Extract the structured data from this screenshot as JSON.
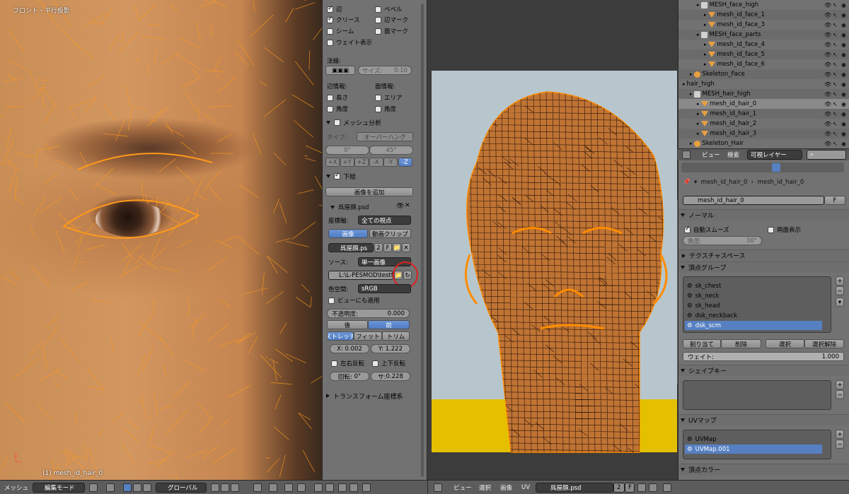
{
  "viewport_left": {
    "label": "フロント・平行投影",
    "object_label": "(1) mesh_id_hair_0"
  },
  "props": {
    "cb_edges": "辺",
    "cb_bevel": "ベベル",
    "cb_crease": "クリース",
    "cb_edge_mark": "辺マーク",
    "cb_seam": "シーム",
    "cb_face_mark": "面マーク",
    "cb_weight": "ウェイト表示",
    "normals_label": "法線:",
    "size_label": "サイズ:",
    "size_value": "0.10",
    "edge_info": "辺情報:",
    "face_info": "面情報:",
    "length": "長さ",
    "area": "エリア",
    "angle1": "角度",
    "angle2": "角度",
    "mesh_analysis": "メッシュ分析",
    "type_label": "タイプ:",
    "type_value": "オーバーハング",
    "min_angle": "0°",
    "max_angle": "45°",
    "axes": [
      "+X",
      "+Y",
      "+Z",
      "-X",
      "-Y",
      "-Z"
    ],
    "background": "下絵",
    "add_image": "画像を追加",
    "image_name": "呉屋顔.psd",
    "axis_label": "座標軸:",
    "axis_value": "全ての視点",
    "tab_image": "画像",
    "tab_movie": "動画クリップ",
    "img_field": "呉屋顔.ps",
    "img_num": "2",
    "img_f": "F",
    "source_label": "ソース:",
    "source_value": "単一画像",
    "filepath": "L:\\L-PESMOD\\testf...",
    "colorspace_label": "色空間:",
    "colorspace_value": "sRGB",
    "apply_view": "ビューにも適用",
    "opacity_label": "不透明度:",
    "opacity_value": "0.000",
    "back": "後",
    "front": "前",
    "stretch": "ストレッチ",
    "fit": "フィット",
    "trim": "トリム",
    "x_label": "X:",
    "x_value": "0.002",
    "y_label": "Y:",
    "y_value": "1.222",
    "flip_x": "左右反転",
    "flip_y": "上下反転",
    "rot_label": "回転:",
    "rot_value": "0°",
    "size2_label": "サ:",
    "size2_value": "0.228",
    "transform": "トランスフォーム座標系"
  },
  "outliner": {
    "rows": [
      {
        "name": "MESH_face_high",
        "indent": 2,
        "icon": "arm"
      },
      {
        "name": "mesh_id_face_1",
        "indent": 3,
        "icon": "mesh"
      },
      {
        "name": "mesh_id_face_3",
        "indent": 3,
        "icon": "mesh"
      },
      {
        "name": "MESH_face_parts",
        "indent": 2,
        "icon": "arm"
      },
      {
        "name": "mesh_id_face_4",
        "indent": 3,
        "icon": "mesh"
      },
      {
        "name": "mesh_id_face_5",
        "indent": 3,
        "icon": "mesh"
      },
      {
        "name": "mesh_id_face_6",
        "indent": 3,
        "icon": "mesh"
      },
      {
        "name": "Skeleton_Face",
        "indent": 1,
        "icon": "obj"
      },
      {
        "name": "hair_high",
        "indent": 0,
        "icon": "none"
      },
      {
        "name": "MESH_hair_high",
        "indent": 1,
        "icon": "arm"
      },
      {
        "name": "mesh_id_hair_0",
        "indent": 2,
        "icon": "mesh",
        "selected": true
      },
      {
        "name": "mesh_id_hair_1",
        "indent": 2,
        "icon": "mesh"
      },
      {
        "name": "mesh_id_hair_2",
        "indent": 2,
        "icon": "mesh"
      },
      {
        "name": "mesh_id_hair_3",
        "indent": 2,
        "icon": "mesh"
      },
      {
        "name": "Skeleton_Hair",
        "indent": 1,
        "icon": "obj"
      }
    ]
  },
  "right_header": {
    "view": "ビュー",
    "search": "検索",
    "layer": "可視レイヤー"
  },
  "right_props": {
    "breadcrumb1": "mesh_id_hair_0",
    "breadcrumb2": "mesh_id_hair_0",
    "data_name": "mesh_id_hair_0",
    "data_f": "F",
    "normals": "ノーマル",
    "autosmooth": "自動スムーズ",
    "double_sided": "両面表示",
    "angle_label": "角度:",
    "angle_value": "30°",
    "texture_space": "テクスチャスペース",
    "vertex_groups": "頂点グループ",
    "groups": [
      "sk_chest",
      "sk_neck",
      "sk_head",
      "dsk_neckback",
      "dsk_scm"
    ],
    "assign": "割り当て",
    "remove": "削除",
    "select": "選択",
    "deselect": "選択解除",
    "weight_label": "ウェイト:",
    "weight_value": "1.000",
    "shape_keys": "シェイプキー",
    "uv_maps": "UVマップ",
    "uvs": [
      "UVMap",
      "UVMap.001"
    ],
    "vertex_colors": "頂点カラー"
  },
  "bottom_left": {
    "mesh": "メッシュ",
    "mode": "編集モード",
    "pivot": "グローバル"
  },
  "bottom_center": {
    "view": "ビュー",
    "select": "選択",
    "image": "画像",
    "uv": "UV",
    "image_name": "呉屋顔.psd",
    "num": "2",
    "f": "F"
  }
}
